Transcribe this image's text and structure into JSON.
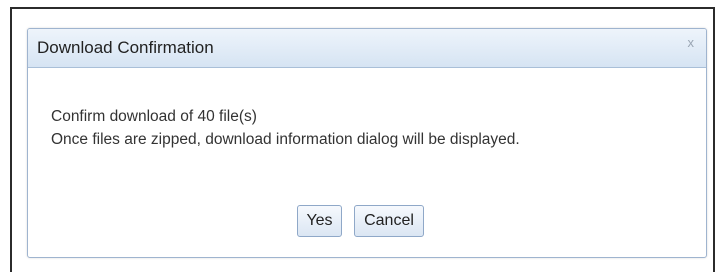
{
  "dialog": {
    "title": "Download Confirmation",
    "close_label": "x",
    "message_line1": "Confirm download of 40 file(s)",
    "message_line2": "Once files are zipped, download information dialog will be displayed.",
    "yes_label": "Yes",
    "cancel_label": "Cancel"
  }
}
